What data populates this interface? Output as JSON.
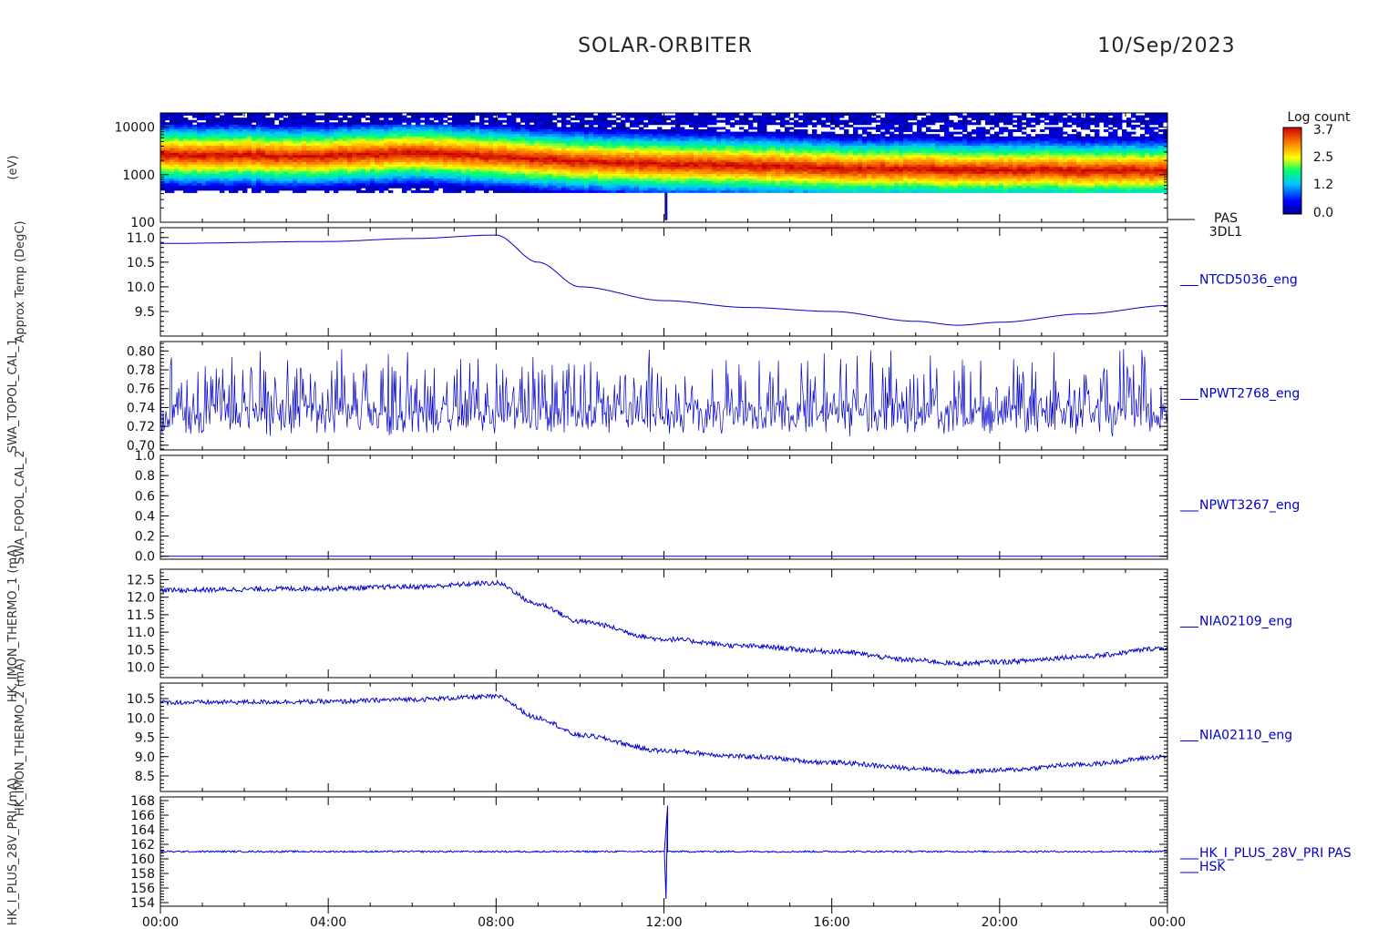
{
  "header": {
    "mission": "SOLAR-ORBITER",
    "date": "10/Sep/2023"
  },
  "colorbar": {
    "title": "Log count",
    "ticks": [
      "3.7",
      "2.5",
      "1.2",
      "0.0"
    ]
  },
  "chart_data": {
    "type": "line",
    "x_tick_labels": [
      "00:00",
      "04:00",
      "08:00",
      "12:00",
      "16:00",
      "20:00",
      "00:00"
    ],
    "x_range_hours": [
      0,
      24
    ],
    "panels": [
      {
        "type": "heatmap",
        "ylabel": "(eV)",
        "right_label": "PAS",
        "right_label2": "3DL1",
        "y_scale": "log",
        "ylim": [
          100,
          20000
        ],
        "y_ticks": [
          "10000",
          "1000",
          "100"
        ],
        "peak_energy_eV": [
          [
            0,
            2600
          ],
          [
            1,
            2500
          ],
          [
            2,
            2600
          ],
          [
            3,
            2400
          ],
          [
            4,
            2500
          ],
          [
            5,
            2700
          ],
          [
            6,
            2900
          ],
          [
            7,
            2700
          ],
          [
            8,
            2400
          ],
          [
            9,
            2100
          ],
          [
            10,
            1900
          ],
          [
            11,
            1750
          ],
          [
            12,
            1650
          ],
          [
            13,
            1600
          ],
          [
            14,
            1550
          ],
          [
            15,
            1450
          ],
          [
            16,
            1350
          ],
          [
            17,
            1300
          ],
          [
            18,
            1300
          ],
          [
            19,
            1250
          ],
          [
            20,
            1250
          ],
          [
            21,
            1250
          ],
          [
            22,
            1200
          ],
          [
            23,
            1200
          ],
          [
            24,
            1200
          ]
        ]
      },
      {
        "type": "line",
        "ylabel": "Approx Temp (DegC)",
        "right_label": "NTCD5036_eng",
        "ylim": [
          9.0,
          11.2
        ],
        "y_ticks": [
          "11.0",
          "10.5",
          "10.0",
          "9.5"
        ],
        "noise": 0,
        "series": [
          {
            "x": [
              0,
              4,
              6,
              8,
              9,
              10,
              12,
              14,
              16,
              18,
              19,
              20,
              22,
              24
            ],
            "y": [
              10.88,
              10.92,
              10.98,
              11.05,
              10.5,
              10.0,
              9.72,
              9.58,
              9.5,
              9.3,
              9.22,
              9.28,
              9.45,
              9.62
            ]
          }
        ]
      },
      {
        "type": "line",
        "ylabel": "SWA_TOPOL_CAL_1",
        "right_label": "NPWT2768_eng",
        "ylim": [
          0.695,
          0.81
        ],
        "y_ticks": [
          "0.80",
          "0.78",
          "0.76",
          "0.74",
          "0.72",
          "0.70"
        ],
        "noise": "spiky",
        "series": [
          {
            "x": [
              0,
              24
            ],
            "y": [
              0.73,
              0.73
            ]
          }
        ]
      },
      {
        "type": "line",
        "ylabel": "SWA_FOPOL_CAL_2",
        "right_label": "NPWT3267_eng",
        "ylim": [
          -0.03,
          1.0
        ],
        "y_ticks": [
          "1.0",
          "0.8",
          "0.6",
          "0.4",
          "0.2",
          "0.0"
        ],
        "noise": 0,
        "series": [
          {
            "x": [
              0,
              24
            ],
            "y": [
              0.0,
              0.0
            ]
          }
        ]
      },
      {
        "type": "line",
        "ylabel": "HK_IMON_THERMO_1 (mA)",
        "right_label": "NIA02109_eng",
        "ylim": [
          9.7,
          12.8
        ],
        "y_ticks": [
          "12.5",
          "12.0",
          "11.5",
          "11.0",
          "10.5",
          "10.0"
        ],
        "noise": 0.07,
        "series": [
          {
            "x": [
              0,
              4,
              6,
              8,
              9,
              10,
              12,
              14,
              16,
              18,
              19,
              20,
              22,
              24
            ],
            "y": [
              12.2,
              12.25,
              12.3,
              12.4,
              11.8,
              11.3,
              10.8,
              10.6,
              10.45,
              10.2,
              10.1,
              10.15,
              10.3,
              10.55
            ]
          }
        ]
      },
      {
        "type": "line",
        "ylabel": "HK_IMON_THERMO_2 (mA)",
        "right_label": "NIA02110_eng",
        "ylim": [
          8.1,
          10.9
        ],
        "y_ticks": [
          "10.5",
          "10.0",
          "9.5",
          "9.0",
          "8.5"
        ],
        "noise": 0.06,
        "series": [
          {
            "x": [
              0,
              4,
              6,
              8,
              9,
              10,
              12,
              14,
              16,
              18,
              19,
              20,
              22,
              24
            ],
            "y": [
              10.4,
              10.42,
              10.48,
              10.55,
              10.0,
              9.55,
              9.15,
              9.0,
              8.85,
              8.7,
              8.6,
              8.65,
              8.8,
              9.0
            ]
          }
        ]
      },
      {
        "type": "line",
        "ylabel": "HK_I_PLUS_28V_PRI (mA)",
        "right_label": "HK_I_PLUS_28V_PRI PAS",
        "right_label2": "HSK",
        "ylim": [
          153.5,
          168.5
        ],
        "y_ticks": [
          "168",
          "166",
          "164",
          "162",
          "160",
          "158",
          "156",
          "154"
        ],
        "noise": 0.12,
        "spike": {
          "x": 12.05,
          "down": 154.5,
          "up": 167.3
        },
        "series": [
          {
            "x": [
              0,
              24
            ],
            "y": [
              161.0,
              161.0
            ]
          }
        ]
      }
    ]
  }
}
